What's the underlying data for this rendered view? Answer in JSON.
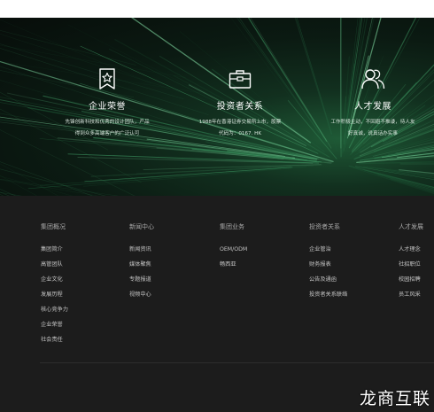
{
  "hero": {
    "features": [
      {
        "icon": "award-badge-icon",
        "title": "企业荣誉",
        "desc": "先锋创新科技和优秀的设计团队，产品\n得到众多高端客户的广泛认可"
      },
      {
        "icon": "briefcase-icon",
        "title": "投资者关系",
        "desc": "1988年在香港证券交易所上市，股票\n代码为：0167. HK"
      },
      {
        "icon": "users-icon",
        "title": "人才发展",
        "desc": "工作积极主动，不回避不推诿，待人友\n好真诚，说真话办实事"
      }
    ]
  },
  "footer": {
    "columns": [
      {
        "heading": "集团概况",
        "links": [
          "集团简介",
          "高管团队",
          "企业文化",
          "发展历程",
          "核心竞争力",
          "企业荣誉",
          "社会责任"
        ]
      },
      {
        "heading": "新闻中心",
        "links": [
          "新闻资讯",
          "媒体聚焦",
          "专题报道",
          "视频中心"
        ]
      },
      {
        "heading": "集团业务",
        "links": [
          "OEM/ODM",
          "畅西亚"
        ]
      },
      {
        "heading": "投资者关系",
        "links": [
          "企业管治",
          "财务报表",
          "公告及通函",
          "投资者关系联络"
        ]
      },
      {
        "heading": "人才发展",
        "links": [
          "人才理念",
          "社招职位",
          "校园招聘",
          "员工风采"
        ]
      }
    ]
  },
  "watermark": "龙商互联",
  "colors": {
    "hero_dark": "#070d0a",
    "hero_green": "#1f5a36",
    "footer_bg": "#1c1c1c",
    "text_light": "#ffffff"
  }
}
